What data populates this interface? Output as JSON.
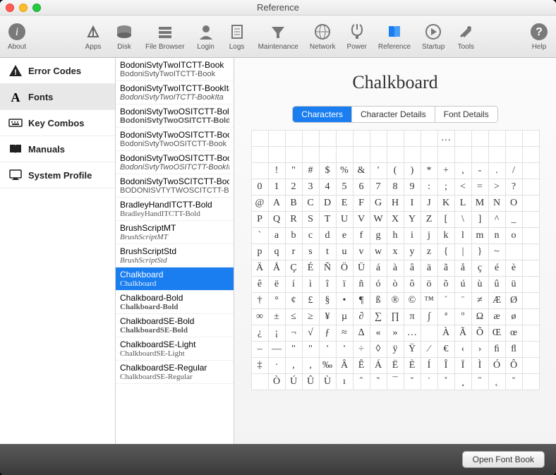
{
  "window": {
    "title": "Reference"
  },
  "toolbar": {
    "about": "About",
    "apps": "Apps",
    "disk": "Disk",
    "file_browser": "File Browser",
    "login": "Login",
    "logs": "Logs",
    "maintenance": "Maintenance",
    "network": "Network",
    "power": "Power",
    "reference": "Reference",
    "startup": "Startup",
    "tools": "Tools",
    "help": "Help"
  },
  "sidebar": {
    "items": [
      {
        "label": "Error Codes"
      },
      {
        "label": "Fonts"
      },
      {
        "label": "Key Combos"
      },
      {
        "label": "Manuals"
      },
      {
        "label": "System Profile"
      }
    ]
  },
  "fonts": [
    {
      "name": "BodoniSvtyTwoITCTT-Book",
      "sample": "BodoniSvtyTwoITCTT-Book",
      "style": ""
    },
    {
      "name": "BodoniSvtyTwoITCTT-BookIta",
      "sample": "BodoniSvtyTwoITCTT-BookIta",
      "style": "fs-italic"
    },
    {
      "name": "BodoniSvtyTwoOSITCTT-Bold",
      "sample": "BodoniSvtyTwoOSITCTT-Bold",
      "style": "fs-bold"
    },
    {
      "name": "BodoniSvtyTwoOSITCTT-Book",
      "sample": "BodoniSvtyTwoOSITCTT-Book",
      "style": ""
    },
    {
      "name": "BodoniSvtyTwoOSITCTT-BookIt",
      "sample": "BodoniSvtyTwoOSITCTT-BookIt",
      "style": "fs-italic"
    },
    {
      "name": "BodoniSvtyTwoSCITCTT-Book",
      "sample": "BODONISVTYTWOSCITCTT-BOOK",
      "style": ""
    },
    {
      "name": "BradleyHandITCTT-Bold",
      "sample": "BradleyHandITCTT-Bold",
      "style": "fs-cursive"
    },
    {
      "name": "BrushScriptMT",
      "sample": "BrushScriptMT",
      "style": "fs-cursive fs-italic"
    },
    {
      "name": "BrushScriptStd",
      "sample": "BrushScriptStd",
      "style": "fs-cursive fs-italic"
    },
    {
      "name": "Chalkboard",
      "sample": "Chalkboard",
      "style": "fs-comic",
      "selected": true
    },
    {
      "name": "Chalkboard-Bold",
      "sample": "Chalkboard-Bold",
      "style": "fs-comic fs-bold"
    },
    {
      "name": "ChalkboardSE-Bold",
      "sample": "ChalkboardSE-Bold",
      "style": "fs-comic fs-bold"
    },
    {
      "name": "ChalkboardSE-Light",
      "sample": "ChalkboardSE-Light",
      "style": "fs-comic"
    },
    {
      "name": "ChalkboardSE-Regular",
      "sample": "ChalkboardSE-Regular",
      "style": "fs-comic"
    }
  ],
  "detail": {
    "title": "Chalkboard",
    "tabs": {
      "characters": "Characters",
      "character_details": "Character Details",
      "font_details": "Font Details"
    }
  },
  "char_rows": [
    [
      "",
      "",
      "",
      "",
      "",
      "",
      "",
      "",
      "",
      "",
      "",
      "…",
      "",
      "",
      "",
      "",
      ""
    ],
    [
      "",
      "",
      "",
      "",
      "",
      "",
      "",
      "",
      "",
      "",
      "",
      "",
      "",
      "",
      "",
      "",
      ""
    ],
    [
      "",
      "!",
      "\"",
      "#",
      "$",
      "%",
      "&",
      "'",
      "(",
      ")",
      "*",
      "+",
      ",",
      "-",
      ".",
      "/",
      ""
    ],
    [
      "0",
      "1",
      "2",
      "3",
      "4",
      "5",
      "6",
      "7",
      "8",
      "9",
      ":",
      ";",
      "<",
      "=",
      ">",
      "?",
      ""
    ],
    [
      "@",
      "A",
      "B",
      "C",
      "D",
      "E",
      "F",
      "G",
      "H",
      "I",
      "J",
      "K",
      "L",
      "M",
      "N",
      "O",
      ""
    ],
    [
      "P",
      "Q",
      "R",
      "S",
      "T",
      "U",
      "V",
      "W",
      "X",
      "Y",
      "Z",
      "[",
      "\\",
      "]",
      "^",
      "_",
      ""
    ],
    [
      "`",
      "a",
      "b",
      "c",
      "d",
      "e",
      "f",
      "g",
      "h",
      "i",
      "j",
      "k",
      "l",
      "m",
      "n",
      "o",
      ""
    ],
    [
      "p",
      "q",
      "r",
      "s",
      "t",
      "u",
      "v",
      "w",
      "x",
      "y",
      "z",
      "{",
      "|",
      "}",
      "~",
      "",
      ""
    ],
    [
      "Ä",
      "Å",
      "Ç",
      "É",
      "Ñ",
      "Ö",
      "Ü",
      "á",
      "à",
      "â",
      "ä",
      "ã",
      "å",
      "ç",
      "é",
      "è",
      ""
    ],
    [
      "ê",
      "ë",
      "í",
      "ì",
      "î",
      "ï",
      "ñ",
      "ó",
      "ò",
      "ô",
      "ö",
      "õ",
      "ú",
      "ù",
      "û",
      "ü",
      ""
    ],
    [
      "†",
      "°",
      "¢",
      "£",
      "§",
      "•",
      "¶",
      "ß",
      "®",
      "©",
      "™",
      "´",
      "¨",
      "≠",
      "Æ",
      "Ø",
      ""
    ],
    [
      "∞",
      "±",
      "≤",
      "≥",
      "¥",
      "µ",
      "∂",
      "∑",
      "∏",
      "π",
      "∫",
      "ª",
      "º",
      "Ω",
      "æ",
      "ø",
      ""
    ],
    [
      "¿",
      "¡",
      "¬",
      "√",
      "ƒ",
      "≈",
      "∆",
      "«",
      "»",
      "…",
      "",
      "À",
      "Ã",
      "Õ",
      "Œ",
      "œ",
      ""
    ],
    [
      "–",
      "—",
      "\"",
      "\"",
      "'",
      "'",
      "÷",
      "◊",
      "ÿ",
      "Ÿ",
      "⁄",
      "€",
      "‹",
      "›",
      "ﬁ",
      "ﬂ",
      ""
    ],
    [
      "‡",
      "·",
      ",",
      "‚",
      "‰",
      "Â",
      "Ê",
      "Á",
      "Ë",
      "È",
      "Í",
      "Î",
      "Ï",
      "Ì",
      "Ó",
      "Ô",
      ""
    ],
    [
      "",
      "Ò",
      "Ú",
      "Û",
      "Ù",
      "ı",
      "ˆ",
      "˜",
      "¯",
      "˘",
      "˙",
      "˚",
      "¸",
      "˝",
      "˛",
      "ˇ",
      ""
    ]
  ],
  "footer": {
    "open_font_book": "Open Font Book"
  }
}
